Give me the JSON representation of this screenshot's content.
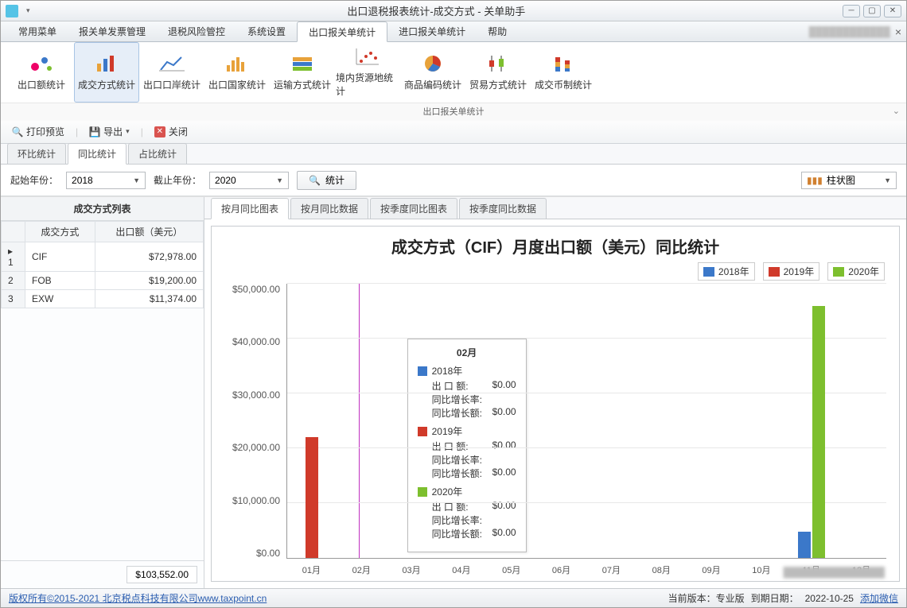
{
  "window": {
    "title": "出口退税报表统计-成交方式 - 关单助手"
  },
  "menus": [
    "常用菜单",
    "报关单发票管理",
    "退税风险管控",
    "系统设置",
    "出口报关单统计",
    "进口报关单统计",
    "帮助"
  ],
  "menu_active_index": 4,
  "menubar_right": {
    "close_x": "×",
    "blur_text": "████████████"
  },
  "ribbon": {
    "group_label": "出口报关单统计",
    "items": [
      {
        "label": "出口额统计",
        "icon": "bubble"
      },
      {
        "label": "成交方式统计",
        "icon": "bars",
        "active": true
      },
      {
        "label": "出口口岸统计",
        "icon": "line"
      },
      {
        "label": "出口国家统计",
        "icon": "histogram"
      },
      {
        "label": "运输方式统计",
        "icon": "stack"
      },
      {
        "label": "境内货源地统计",
        "icon": "scatter"
      },
      {
        "label": "商品编码统计",
        "icon": "pie"
      },
      {
        "label": "贸易方式统计",
        "icon": "candle"
      },
      {
        "label": "成交币制统计",
        "icon": "stackbar"
      }
    ]
  },
  "toolbar2": {
    "print": "打印预览",
    "export": "导出",
    "close": "关闭"
  },
  "tabs1": [
    "环比统计",
    "同比统计",
    "占比统计"
  ],
  "tabs1_active": 1,
  "filter": {
    "start_label": "起始年份：",
    "start_value": "2018",
    "end_label": "截止年份：",
    "end_value": "2020",
    "stat_btn": "统计",
    "chart_type": "柱状图"
  },
  "leftpane": {
    "header": "成交方式列表",
    "cols": [
      "",
      "成交方式",
      "出口额（美元）"
    ],
    "rows": [
      {
        "idx": "1",
        "mode": "CIF",
        "amount": "$72,978.00",
        "sel": true
      },
      {
        "idx": "2",
        "mode": "FOB",
        "amount": "$19,200.00"
      },
      {
        "idx": "3",
        "mode": "EXW",
        "amount": "$11,374.00"
      }
    ],
    "total": "$103,552.00"
  },
  "tabs2": [
    "按月同比图表",
    "按月同比数据",
    "按季度同比图表",
    "按季度同比数据"
  ],
  "tabs2_active": 0,
  "chart": {
    "title": "成交方式（CIF）月度出口额（美元）同比统计",
    "legend": [
      {
        "name": "2018年",
        "color": "#3b78c9"
      },
      {
        "name": "2019年",
        "color": "#d03a2a"
      },
      {
        "name": "2020年",
        "color": "#7dbf2e"
      }
    ],
    "colors": {
      "2018": "#3b78c9",
      "2019": "#d03a2a",
      "2020": "#7dbf2e"
    },
    "blur_footer": "███████████████"
  },
  "chart_data": {
    "type": "bar",
    "title": "成交方式（CIF）月度出口额（美元）同比统计",
    "xlabel": "",
    "ylabel": "",
    "ylim": [
      0,
      50000
    ],
    "yticks": [
      "$0.00",
      "$10,000.00",
      "$20,000.00",
      "$30,000.00",
      "$40,000.00",
      "$50,000.00"
    ],
    "categories": [
      "01月",
      "02月",
      "03月",
      "04月",
      "05月",
      "06月",
      "07月",
      "08月",
      "09月",
      "10月",
      "11月",
      "12月"
    ],
    "series": [
      {
        "name": "2018年",
        "values": [
          0,
          0,
          0,
          0,
          0,
          0,
          0,
          0,
          0,
          0,
          4800,
          0
        ]
      },
      {
        "name": "2019年",
        "values": [
          22000,
          0,
          0,
          0,
          0,
          0,
          0,
          0,
          0,
          0,
          0,
          0
        ]
      },
      {
        "name": "2020年",
        "values": [
          0,
          0,
          0,
          0,
          0,
          0,
          0,
          0,
          0,
          0,
          46000,
          0
        ]
      }
    ]
  },
  "tooltip": {
    "month": "02月",
    "groups": [
      {
        "series": "2018年",
        "color": "#3b78c9",
        "rows": [
          [
            "出 口 额:",
            "$0.00"
          ],
          [
            "同比增长率:",
            ""
          ],
          [
            "同比增长额:",
            "$0.00"
          ]
        ]
      },
      {
        "series": "2019年",
        "color": "#d03a2a",
        "rows": [
          [
            "出 口 额:",
            "$0.00"
          ],
          [
            "同比增长率:",
            ""
          ],
          [
            "同比增长额:",
            "$0.00"
          ]
        ]
      },
      {
        "series": "2020年",
        "color": "#7dbf2e",
        "rows": [
          [
            "出 口 额:",
            "$0.00"
          ],
          [
            "同比增长率:",
            ""
          ],
          [
            "同比增长额:",
            "$0.00"
          ]
        ]
      }
    ]
  },
  "status": {
    "copyright": "版权所有©2015-2021 北京税点科技有限公司www.taxpoint.cn",
    "version_label": "当前版本：专业版",
    "expire_label": "到期日期：",
    "expire_date": "2022-10-25",
    "wechat": "添加微信"
  }
}
